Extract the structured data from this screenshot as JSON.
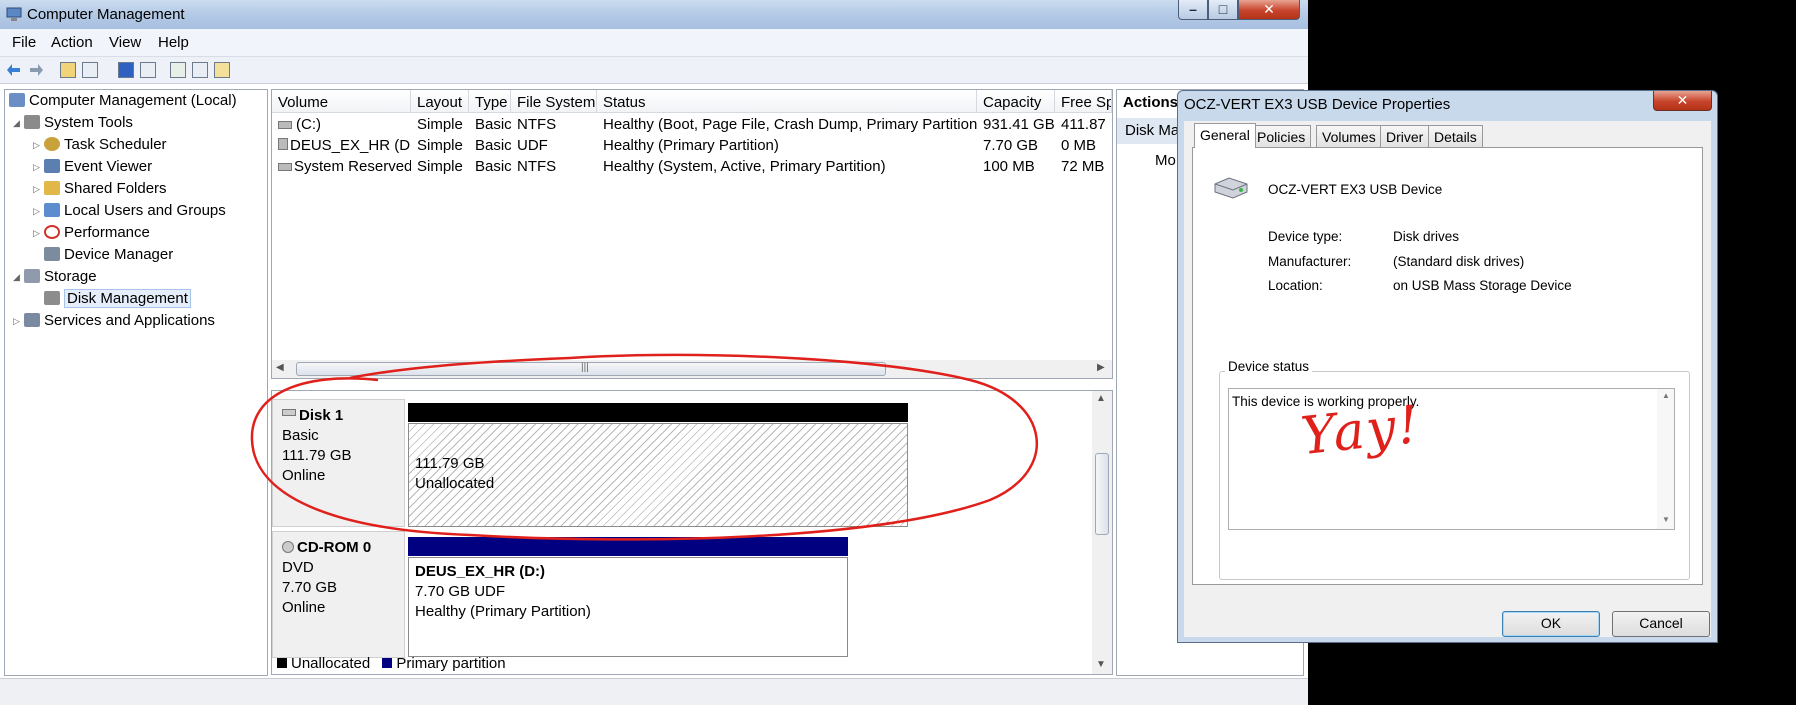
{
  "window": {
    "title": "Computer Management",
    "close_glyph": "✕",
    "min_glyph": "–",
    "max_glyph": "□"
  },
  "menu": [
    "File",
    "Action",
    "View",
    "Help"
  ],
  "tree": {
    "items": [
      {
        "label": "Computer Management (Local)",
        "icon": "computer-icon",
        "color": "#6b8fc4"
      },
      {
        "label": "System Tools",
        "icon": "tools-icon",
        "color": "#8a8a8a"
      },
      {
        "label": "Task Scheduler",
        "icon": "clock-icon",
        "color": "#c9a23c"
      },
      {
        "label": "Event Viewer",
        "icon": "event-viewer-icon",
        "color": "#5a7fb0"
      },
      {
        "label": "Shared Folders",
        "icon": "folder-icon",
        "color": "#e1b74a"
      },
      {
        "label": "Local Users and Groups",
        "icon": "users-icon",
        "color": "#5d8ccf"
      },
      {
        "label": "Performance",
        "icon": "performance-icon",
        "color": "#d0342c"
      },
      {
        "label": "Device Manager",
        "icon": "device-manager-icon",
        "color": "#7c8b9e"
      },
      {
        "label": "Storage",
        "icon": "storage-icon",
        "color": "#8f9aab"
      },
      {
        "label": "Disk Management",
        "icon": "disk-icon",
        "color": "#8c8c8c"
      },
      {
        "label": "Services and Applications",
        "icon": "services-icon",
        "color": "#7a8aa0"
      }
    ]
  },
  "volumes": {
    "columns": [
      "Volume",
      "Layout",
      "Type",
      "File System",
      "Status",
      "Capacity",
      "Free Sp"
    ],
    "rows": [
      [
        "(C:)",
        "Simple",
        "Basic",
        "NTFS",
        "Healthy (Boot, Page File, Crash Dump, Primary Partition)",
        "931.41 GB",
        "411.87"
      ],
      [
        "DEUS_EX_HR (D:)",
        "Simple",
        "Basic",
        "UDF",
        "Healthy (Primary Partition)",
        "7.70 GB",
        "0 MB"
      ],
      [
        "System Reserved",
        "Simple",
        "Basic",
        "NTFS",
        "Healthy (System, Active, Primary Partition)",
        "100 MB",
        "72 MB"
      ]
    ],
    "scroll_grip": "|||"
  },
  "disks": {
    "disk1": {
      "name": "Disk 1",
      "type": "Basic",
      "size": "111.79 GB",
      "state": "Online",
      "partition_size": "111.79 GB",
      "partition_label": "Unallocated"
    },
    "cdrom": {
      "name": "CD-ROM 0",
      "type": "DVD",
      "size": "7.70 GB",
      "state": "Online",
      "volume": "DEUS_EX_HR  (D:)",
      "volume_size": "7.70 GB UDF",
      "volume_status": "Healthy (Primary Partition)"
    },
    "legend": {
      "unallocated": "Unallocated",
      "primary": "Primary partition"
    },
    "colors": {
      "unallocated": "#000000",
      "primary": "#000080"
    }
  },
  "actions": {
    "header": "Actions",
    "section": "Disk Ma",
    "more": "Mo"
  },
  "dialog": {
    "title": "OCZ-VERT EX3 USB Device Properties",
    "close_glyph": "✕",
    "tabs": [
      "General",
      "Policies",
      "Volumes",
      "Driver",
      "Details"
    ],
    "device_name": "OCZ-VERT EX3 USB Device",
    "props": [
      {
        "label": "Device type:",
        "value": "Disk drives"
      },
      {
        "label": "Manufacturer:",
        "value": "(Standard disk drives)"
      },
      {
        "label": "Location:",
        "value": "on USB Mass Storage Device"
      }
    ],
    "status_group": "Device status",
    "status_text": "This device is working properly.",
    "annotation": "Yay!",
    "ok": "OK",
    "cancel": "Cancel"
  }
}
